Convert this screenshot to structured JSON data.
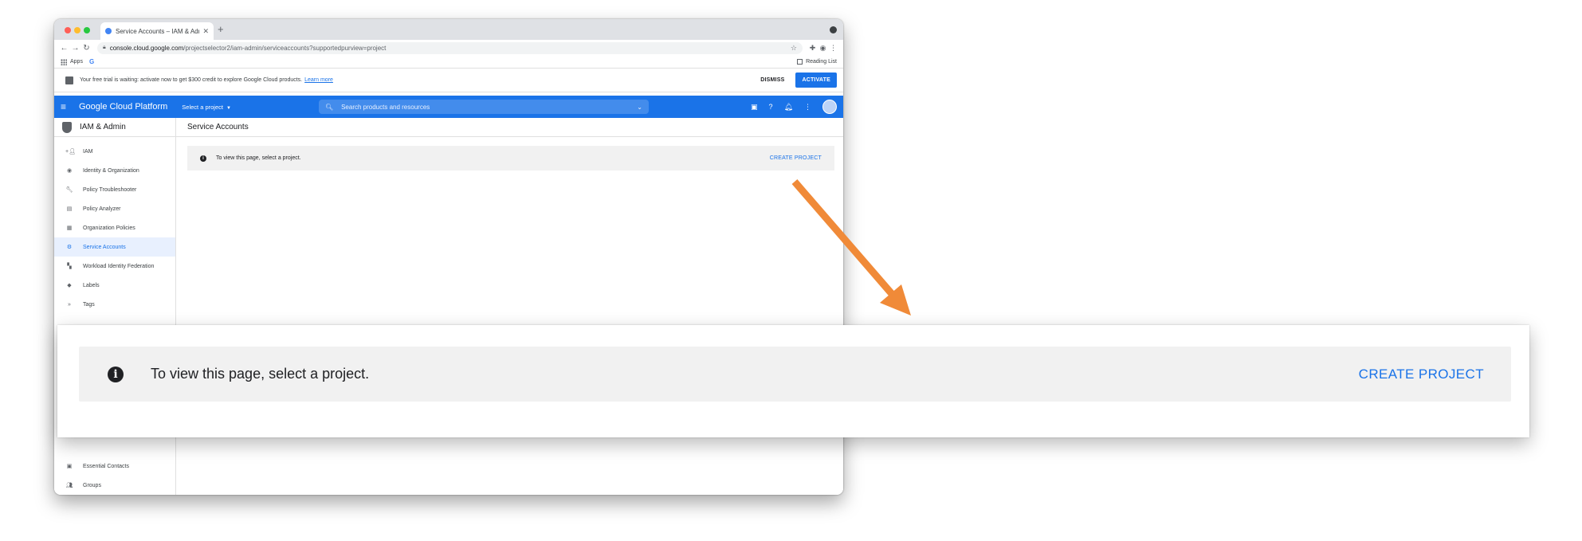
{
  "browser": {
    "tab_title": "Service Accounts – IAM & Admin",
    "new_tab": "+",
    "url_domain": "console.cloud.google.com",
    "url_path": "/projectselector2/iam-admin/serviceaccounts?supportedpurview=project",
    "bookmarks": {
      "apps": "Apps",
      "g": "G",
      "reading_list": "Reading List"
    }
  },
  "trial_banner": {
    "text": "Your free trial is waiting: activate now to get $300 credit to explore Google Cloud products.",
    "learn_more": "Learn more",
    "dismiss": "DISMISS",
    "activate": "ACTIVATE"
  },
  "header": {
    "brand": "Google Cloud Platform",
    "project_select": "Select a project",
    "search_placeholder": "Search products and resources"
  },
  "sidebar": {
    "title": "IAM & Admin",
    "items": [
      {
        "label": "IAM",
        "icon": "person-add-icon"
      },
      {
        "label": "Identity & Organization",
        "icon": "account-circle-icon"
      },
      {
        "label": "Policy Troubleshooter",
        "icon": "wrench-icon"
      },
      {
        "label": "Policy Analyzer",
        "icon": "document-search-icon"
      },
      {
        "label": "Organization Policies",
        "icon": "list-icon"
      },
      {
        "label": "Service Accounts",
        "icon": "service-account-icon",
        "active": true
      },
      {
        "label": "Workload Identity Federation",
        "icon": "grid-icon"
      },
      {
        "label": "Labels",
        "icon": "tag-icon"
      },
      {
        "label": "Tags",
        "icon": "chevrons-icon"
      }
    ],
    "bottom_items": [
      {
        "label": "Essential Contacts",
        "icon": "contacts-icon"
      },
      {
        "label": "Groups",
        "icon": "groups-icon"
      }
    ],
    "collapse": "<|"
  },
  "main": {
    "title": "Service Accounts",
    "notice_text": "To view this page, select a project.",
    "create_project": "CREATE PROJECT"
  },
  "zoom": {
    "notice_text": "To view this page, select a project.",
    "create_project": "CREATE PROJECT"
  },
  "colors": {
    "accent": "#1a73e8",
    "arrow": "#f08a38"
  }
}
